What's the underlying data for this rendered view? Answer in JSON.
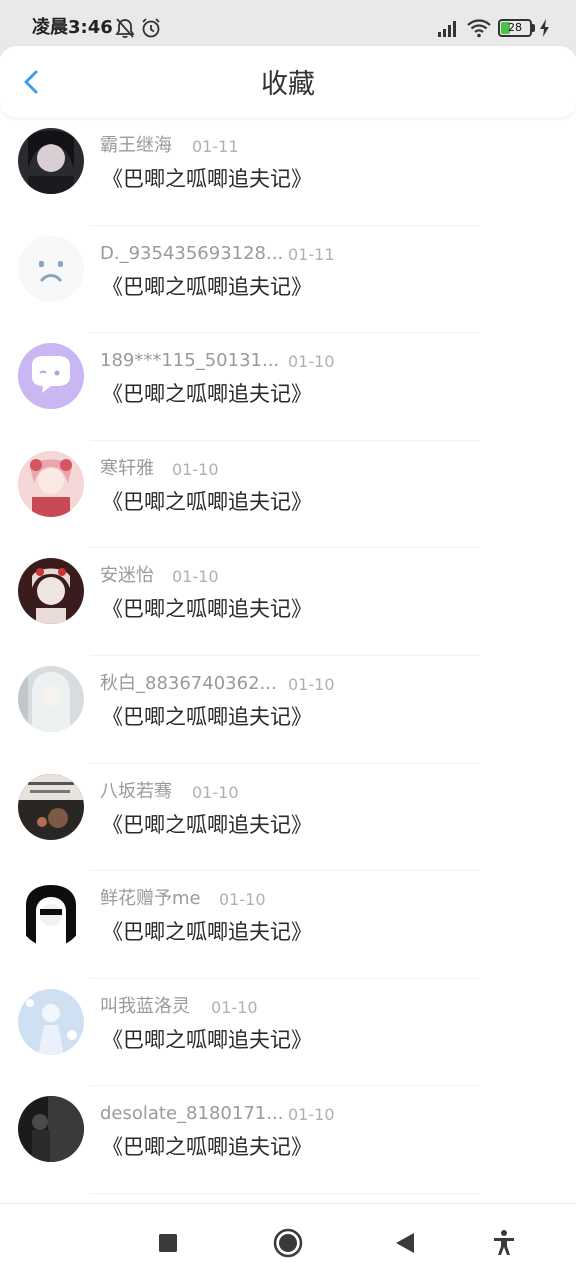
{
  "status_bar": {
    "time": "凌晨3:46",
    "battery_level": "28",
    "icons": [
      "bell-off-icon",
      "alarm-icon",
      "signal-icon",
      "wifi-icon",
      "battery-icon",
      "charging-icon"
    ]
  },
  "header": {
    "title": "收藏",
    "back_icon": "chevron-left-icon",
    "accent_color": "#3aa0e8"
  },
  "favorites": [
    {
      "username": "霸王继海",
      "date": "01-11",
      "title": "《巴唧之呱唧追夫记》"
    },
    {
      "username": "D._935435693128...",
      "date": "01-11",
      "title": "《巴唧之呱唧追夫记》"
    },
    {
      "username": "189***115_50131...",
      "date": "01-10",
      "title": "《巴唧之呱唧追夫记》"
    },
    {
      "username": "寒轩雅",
      "date": "01-10",
      "title": "《巴唧之呱唧追夫记》"
    },
    {
      "username": "安迷怡",
      "date": "01-10",
      "title": "《巴唧之呱唧追夫记》"
    },
    {
      "username": "秋白_8836740362...",
      "date": "01-10",
      "title": "《巴唧之呱唧追夫记》"
    },
    {
      "username": "八坂若骞",
      "date": "01-10",
      "title": "《巴唧之呱唧追夫记》"
    },
    {
      "username": "鲜花赠予me",
      "date": "01-10",
      "title": "《巴唧之呱唧追夫记》"
    },
    {
      "username": "叫我蓝洛灵",
      "date": "01-10",
      "title": "《巴唧之呱唧追夫记》"
    },
    {
      "username": "desolate_8180171...",
      "date": "01-10",
      "title": "《巴唧之呱唧追夫记》"
    }
  ],
  "nav_bar": {
    "buttons": [
      "recents-square-icon",
      "home-circle-icon",
      "back-triangle-icon",
      "accessibility-icon"
    ]
  }
}
